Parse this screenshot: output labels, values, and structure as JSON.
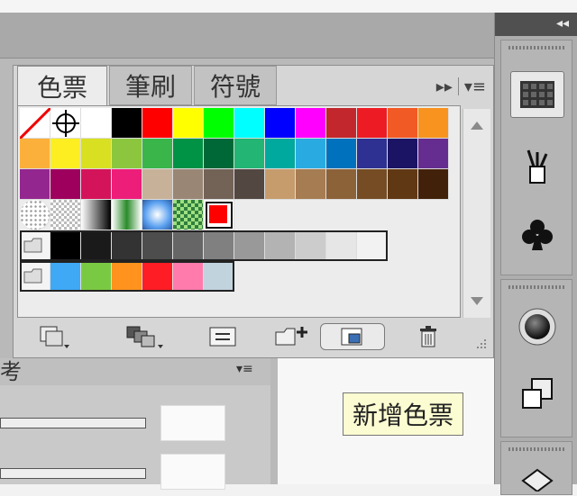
{
  "tabs": [
    {
      "label": "色票"
    },
    {
      "label": "筆刷"
    },
    {
      "label": "符號"
    }
  ],
  "panel_menu": {
    "expand_glyph": "▸▸",
    "menu_glyph": "▾≡"
  },
  "swatch_rows": [
    [
      "none",
      "registration",
      "#ffffff",
      "#000000",
      "#ff0000",
      "#ffff00",
      "#00ff00",
      "#00ffff",
      "#0000ff",
      "#ff00ff",
      "#c1272d",
      "#ed1c24",
      "#f15a24",
      "#f7931e"
    ],
    [
      "#fbb03b",
      "#fcee21",
      "#d9e021",
      "#8cc63f",
      "#39b54a",
      "#009245",
      "#006837",
      "#22b573",
      "#00a99d",
      "#29abe2",
      "#0071bc",
      "#2e3192",
      "#1b1464",
      "#662d91"
    ],
    [
      "#93278f",
      "#9e005d",
      "#d4145a",
      "#ed1e79",
      "#c7b299",
      "#998675",
      "#736357",
      "#534741",
      "#c69c6d",
      "#a67c52",
      "#8c6239",
      "#754c24",
      "#603813",
      "#42210b"
    ]
  ],
  "pattern_row": [
    "pattern-dots",
    "pattern-checker",
    "gradient-linear-gray",
    "gradient-green",
    "gradient-radial-blue",
    "pattern-green",
    "#ff0000"
  ],
  "gray_row": [
    "#000000",
    "#1a1a1a",
    "#333333",
    "#4d4d4d",
    "#666666",
    "#808080",
    "#999999",
    "#b3b3b3",
    "#cccccc",
    "#e6e6e6",
    "#f2f2f2"
  ],
  "color_group_row": [
    "#3fa9f5",
    "#7ac943",
    "#ff931e",
    "#ff1d25",
    "#ff7bac",
    "#c1d3dd"
  ],
  "tooltip": {
    "text": "新增色票"
  },
  "lower_panel": {
    "tab_label": "考",
    "menu_glyph": "▾≡"
  },
  "dock": {
    "collapse_glyph": "◂◂"
  }
}
